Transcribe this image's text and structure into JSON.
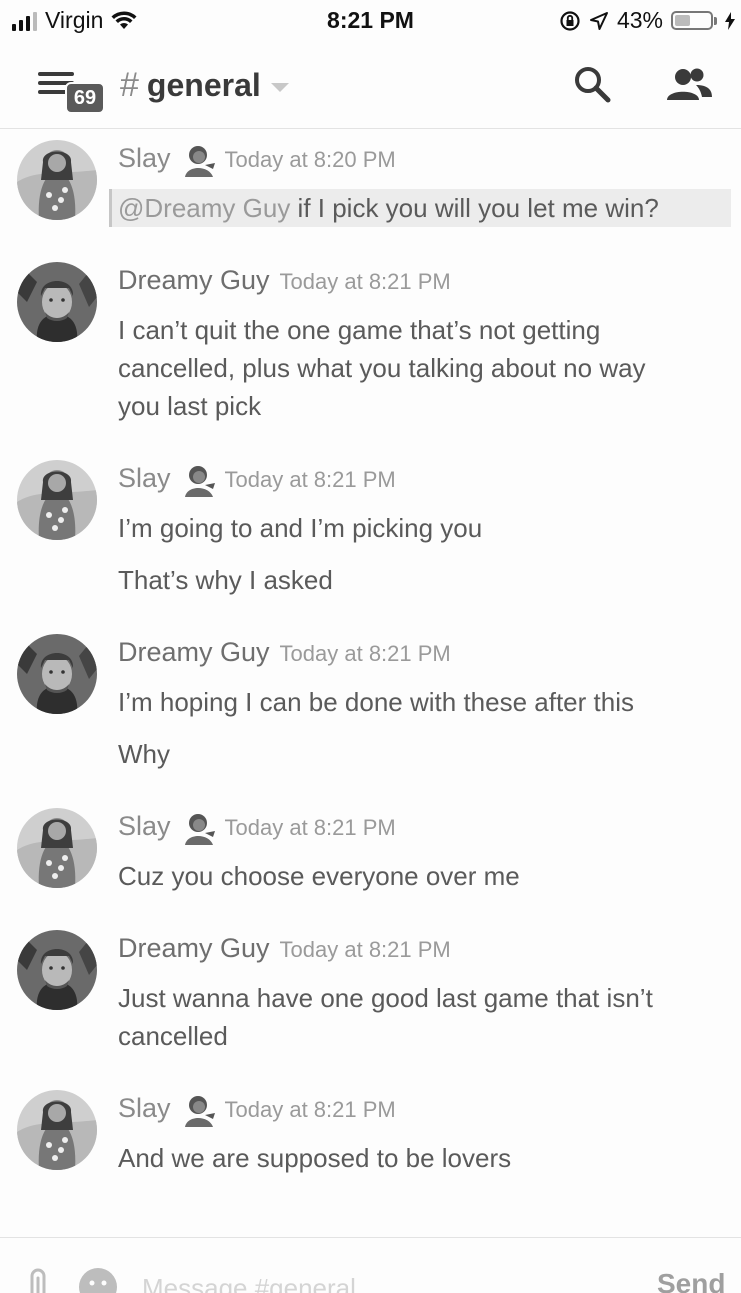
{
  "status_bar": {
    "carrier": "Virgin",
    "time": "8:21 PM",
    "battery_percent": "43%",
    "battery_level": 0.43,
    "icons": [
      "signal-icon",
      "wifi-icon",
      "rotation-lock-icon",
      "location-icon",
      "battery-icon",
      "charging-icon"
    ]
  },
  "header": {
    "menu_badge": "69",
    "channel_hash": "#",
    "channel_name": "general",
    "icons": [
      "menu-icon",
      "chevron-down-icon",
      "search-icon",
      "members-icon"
    ]
  },
  "messages": [
    {
      "author": "Slay",
      "emoji": "🙇‍♀️",
      "timestamp": "Today at 8:20 PM",
      "mention": "@Dreamy Guy",
      "lines": [
        " if I pick you will you let me win?"
      ]
    },
    {
      "author": "Dreamy Guy",
      "timestamp": "Today at 8:21 PM",
      "lines": [
        "I can’t quit the one game that’s not getting",
        "cancelled, plus what you talking about no way",
        "you last pick"
      ]
    },
    {
      "author": "Slay",
      "emoji": "🙇‍♀️",
      "timestamp": "Today at 8:21 PM",
      "lines": [
        "I’m going to and I’m picking you",
        "That’s why I asked"
      ]
    },
    {
      "author": "Dreamy Guy",
      "timestamp": "Today at 8:21 PM",
      "lines": [
        "I’m hoping I can be done with these after this",
        "Why"
      ]
    },
    {
      "author": "Slay",
      "emoji": "🙇‍♀️",
      "timestamp": "Today at 8:21 PM",
      "lines": [
        "Cuz you choose everyone over me"
      ]
    },
    {
      "author": "Dreamy Guy",
      "timestamp": "Today at 8:21 PM",
      "lines": [
        "Just wanna have one good last game that isn’t",
        "cancelled"
      ]
    },
    {
      "author": "Slay",
      "emoji": "🙇‍♀️",
      "timestamp": "Today at 8:21 PM",
      "lines": [
        "And we are supposed to be lovers"
      ]
    }
  ],
  "input": {
    "placeholder": "Message #general",
    "send_label": "Send",
    "icons": [
      "attachment-icon",
      "emoji-icon"
    ]
  },
  "colors": {
    "background": "#fdfdfd",
    "text": "#5a5a5a",
    "muted": "#9a9a9a",
    "badge": "#5a5a5a",
    "mention_bg": "#ececec"
  }
}
